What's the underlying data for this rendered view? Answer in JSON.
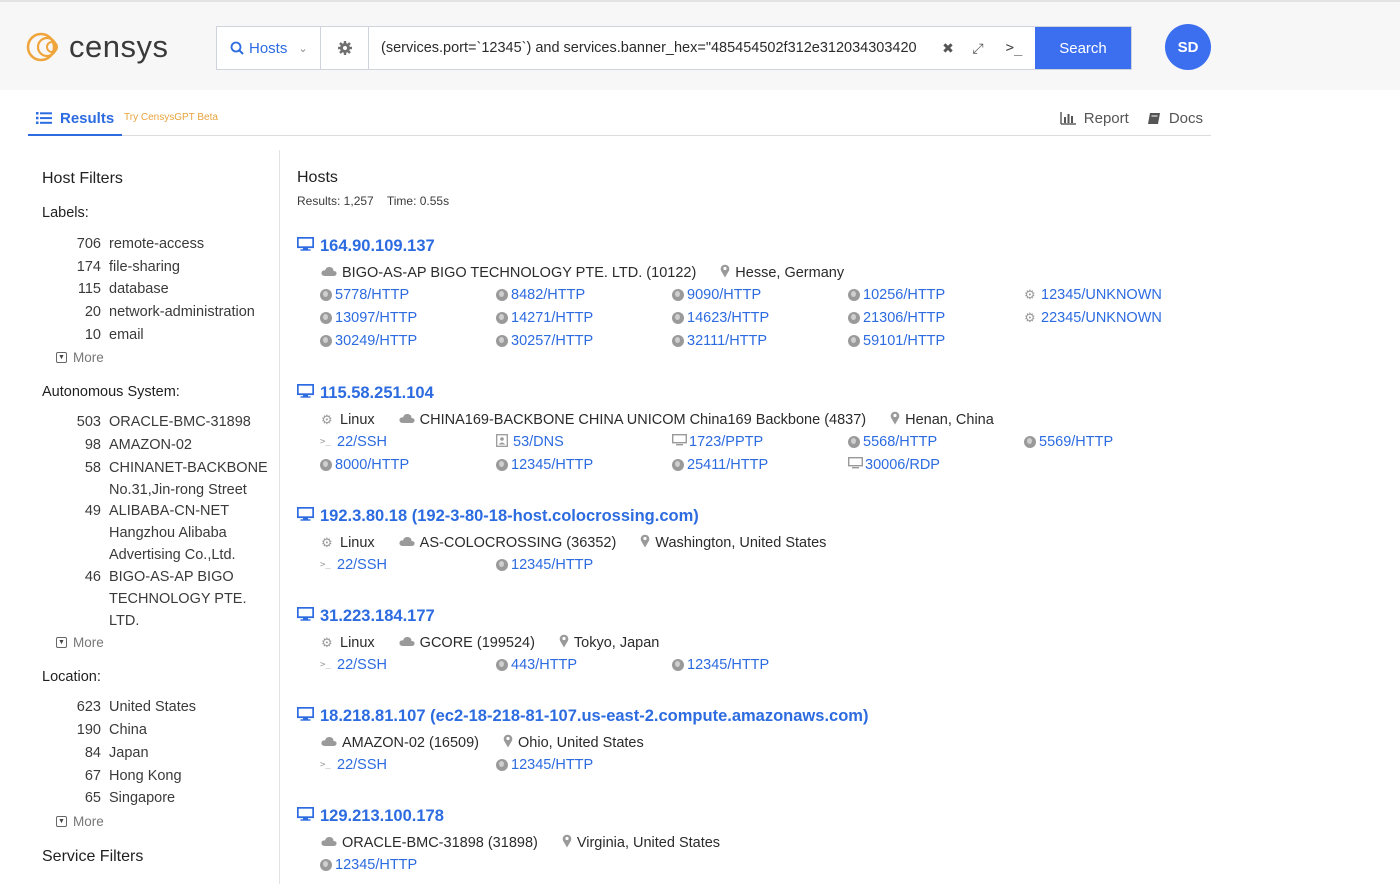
{
  "brand": {
    "name": "censys"
  },
  "search": {
    "type": "Hosts",
    "query": "(services.port=`12345`) and services.banner_hex=\"485454502f312e312034303420",
    "button": "Search"
  },
  "user": {
    "initials": "SD"
  },
  "tabs": {
    "results": "Results",
    "gpt": "Try CensysGPT Beta",
    "report": "Report",
    "docs": "Docs"
  },
  "sidebar": {
    "title": "Host Filters",
    "labels_title": "Labels:",
    "labels": [
      {
        "count": "706",
        "label": "remote-access"
      },
      {
        "count": "174",
        "label": "file-sharing"
      },
      {
        "count": "115",
        "label": "database"
      },
      {
        "count": "20",
        "label": "network-administration"
      },
      {
        "count": "10",
        "label": "email"
      }
    ],
    "more": "More",
    "as_title": "Autonomous System:",
    "as": [
      {
        "count": "503",
        "label": "ORACLE-BMC-31898"
      },
      {
        "count": "98",
        "label": "AMAZON-02"
      },
      {
        "count": "58",
        "label": "CHINANET-BACKBONE No.31,Jin-rong Street"
      },
      {
        "count": "49",
        "label": "ALIBABA-CN-NET Hangzhou Alibaba Advertising Co.,Ltd."
      },
      {
        "count": "46",
        "label": "BIGO-AS-AP BIGO TECHNOLOGY PTE. LTD."
      }
    ],
    "location_title": "Location:",
    "location": [
      {
        "count": "623",
        "label": "United States"
      },
      {
        "count": "190",
        "label": "China"
      },
      {
        "count": "84",
        "label": "Japan"
      },
      {
        "count": "67",
        "label": "Hong Kong"
      },
      {
        "count": "65",
        "label": "Singapore"
      }
    ],
    "service_title": "Service Filters"
  },
  "main": {
    "title": "Hosts",
    "results": "Results: 1,257",
    "time": "Time: 0.55s"
  },
  "hosts": [
    {
      "ip": "164.90.109.137",
      "os": "",
      "asn": "BIGO-AS-AP BIGO TECHNOLOGY PTE. LTD. (10122)",
      "location": "Hesse, Germany",
      "services": [
        {
          "t": "globe",
          "v": "5778/HTTP"
        },
        {
          "t": "globe",
          "v": "8482/HTTP"
        },
        {
          "t": "globe",
          "v": "9090/HTTP"
        },
        {
          "t": "globe",
          "v": "10256/HTTP"
        },
        {
          "t": "cog",
          "v": "12345/UNKNOWN"
        },
        {
          "t": "globe",
          "v": "13097/HTTP"
        },
        {
          "t": "globe",
          "v": "14271/HTTP"
        },
        {
          "t": "globe",
          "v": "14623/HTTP"
        },
        {
          "t": "globe",
          "v": "21306/HTTP"
        },
        {
          "t": "cog",
          "v": "22345/UNKNOWN"
        },
        {
          "t": "globe",
          "v": "30249/HTTP"
        },
        {
          "t": "globe",
          "v": "30257/HTTP"
        },
        {
          "t": "globe",
          "v": "32111/HTTP"
        },
        {
          "t": "globe",
          "v": "59101/HTTP"
        }
      ]
    },
    {
      "ip": "115.58.251.104",
      "os": "Linux",
      "asn": "CHINA169-BACKBONE CHINA UNICOM China169 Backbone (4837)",
      "location": "Henan, China",
      "services": [
        {
          "t": "term",
          "v": "22/SSH"
        },
        {
          "t": "dns",
          "v": "53/DNS"
        },
        {
          "t": "mon",
          "v": "1723/PPTP"
        },
        {
          "t": "globe",
          "v": "5568/HTTP"
        },
        {
          "t": "globe",
          "v": "5569/HTTP"
        },
        {
          "t": "globe",
          "v": "8000/HTTP"
        },
        {
          "t": "globe",
          "v": "12345/HTTP"
        },
        {
          "t": "globe",
          "v": "25411/HTTP"
        },
        {
          "t": "mon",
          "v": "30006/RDP"
        }
      ]
    },
    {
      "ip": "192.3.80.18 (192-3-80-18-host.colocrossing.com)",
      "os": "Linux",
      "asn": "AS-COLOCROSSING (36352)",
      "location": "Washington, United States",
      "services": [
        {
          "t": "term",
          "v": "22/SSH"
        },
        {
          "t": "globe",
          "v": "12345/HTTP"
        }
      ]
    },
    {
      "ip": "31.223.184.177",
      "os": "Linux",
      "asn": "GCORE (199524)",
      "location": "Tokyo, Japan",
      "services": [
        {
          "t": "term",
          "v": "22/SSH"
        },
        {
          "t": "globe",
          "v": "443/HTTP"
        },
        {
          "t": "globe",
          "v": "12345/HTTP"
        }
      ]
    },
    {
      "ip": "18.218.81.107 (ec2-18-218-81-107.us-east-2.compute.amazonaws.com)",
      "os": "",
      "asn": "AMAZON-02 (16509)",
      "location": "Ohio, United States",
      "services": [
        {
          "t": "term",
          "v": "22/SSH"
        },
        {
          "t": "globe",
          "v": "12345/HTTP"
        }
      ]
    },
    {
      "ip": "129.213.100.178",
      "os": "",
      "asn": "ORACLE-BMC-31898 (31898)",
      "location": "Virginia, United States",
      "services": [
        {
          "t": "globe",
          "v": "12345/HTTP"
        }
      ]
    }
  ]
}
